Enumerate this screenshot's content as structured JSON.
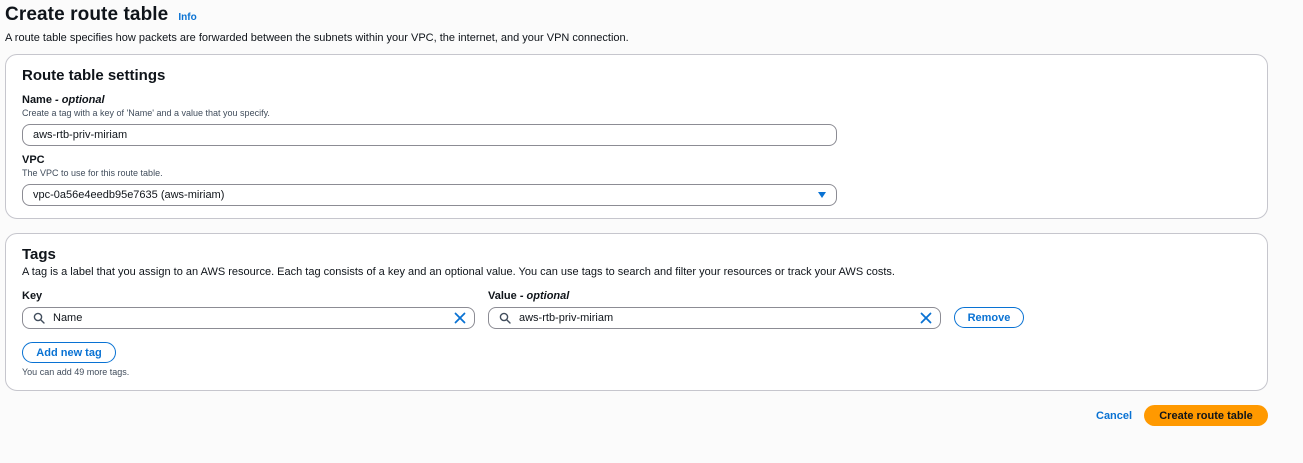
{
  "header": {
    "title": "Create route table",
    "info_label": "Info",
    "description": "A route table specifies how packets are forwarded between the subnets within your VPC, the internet, and your VPN connection."
  },
  "settings": {
    "title": "Route table settings",
    "name_label": "Name",
    "name_optional": "- optional",
    "name_hint": "Create a tag with a key of 'Name' and a value that you specify.",
    "name_value": "aws-rtb-priv-miriam",
    "vpc_label": "VPC",
    "vpc_hint": "The VPC to use for this route table.",
    "vpc_value": "vpc-0a56e4eedb95e7635 (aws-miriam)"
  },
  "tags": {
    "title": "Tags",
    "description": "A tag is a label that you assign to an AWS resource. Each tag consists of a key and an optional value. You can use tags to search and filter your resources or track your AWS costs.",
    "key_label": "Key",
    "value_label": "Value",
    "value_optional": "- optional",
    "key_value": "Name",
    "value_value": "aws-rtb-priv-miriam",
    "remove_label": "Remove",
    "add_label": "Add new tag",
    "remaining_hint": "You can add 49 more tags."
  },
  "actions": {
    "cancel_label": "Cancel",
    "create_label": "Create route table"
  },
  "icons": {
    "search": "search-icon",
    "clear": "close-icon",
    "dropdown": "caret-down-icon"
  },
  "colors": {
    "link": "#0972d3",
    "primary": "#ff9900",
    "border": "#c6c6cd",
    "background": "#fbfbfb"
  }
}
